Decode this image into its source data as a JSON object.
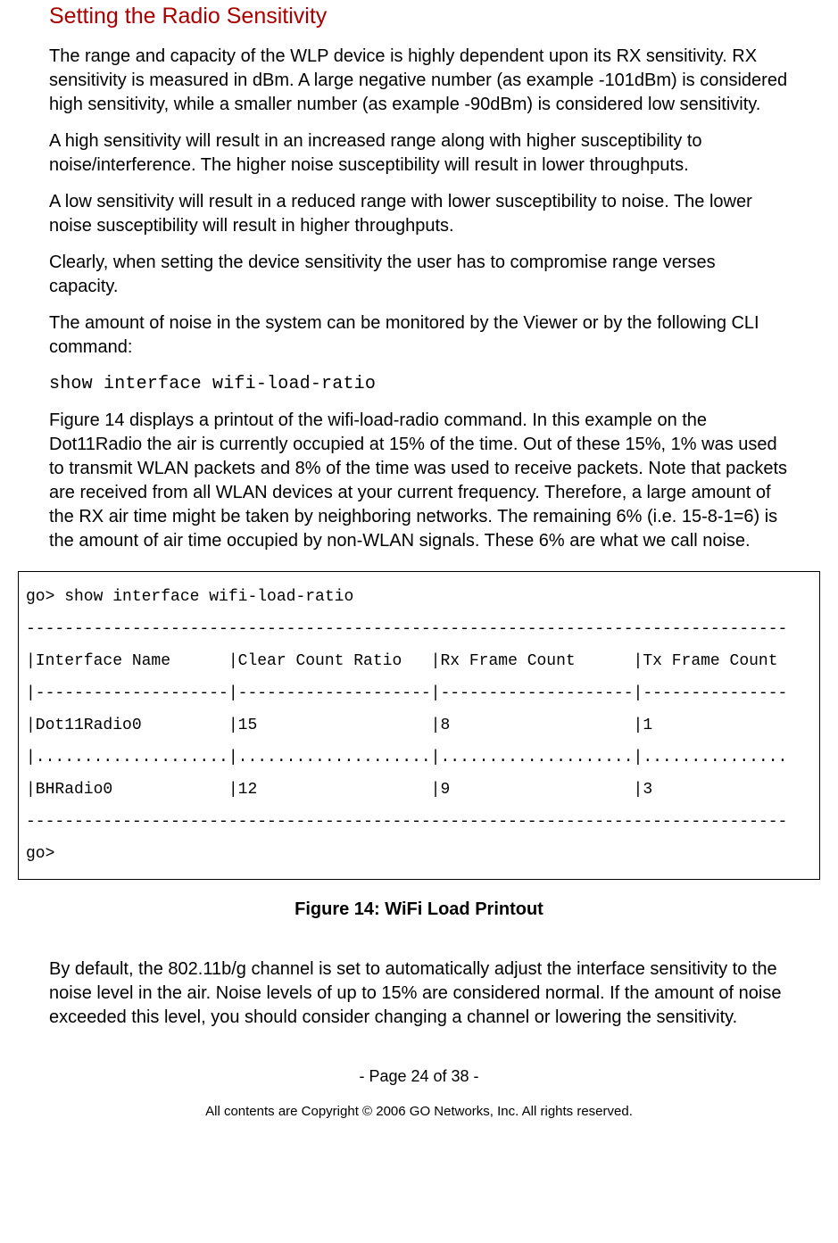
{
  "heading": "Setting the Radio Sensitivity",
  "paragraphs": {
    "p1": "The range and capacity of the WLP device is highly dependent upon its RX sensitivity. RX sensitivity is measured in dBm. A large negative number (as example -101dBm) is considered high sensitivity, while a smaller number (as example -90dBm) is considered low sensitivity.",
    "p2": "A high sensitivity will result in an increased range along with higher susceptibility to noise/interference. The higher noise susceptibility will result in lower throughputs.",
    "p3": "A low sensitivity will result in a reduced range with lower susceptibility to noise. The lower noise susceptibility will result in higher throughputs.",
    "p4": "Clearly, when setting the device sensitivity the user has to compromise range verses capacity.",
    "p5": "The amount of noise in the system can be monitored by the Viewer or by the following CLI command:",
    "cli": "show interface wifi-load-ratio",
    "p6": "Figure 14 displays a printout of the wifi-load-radio command. In this example on the Dot11Radio the air is currently occupied at 15% of the time. Out of these 15%, 1% was used to transmit WLAN packets and 8% of the time was used to receive packets. Note that packets are received from all WLAN devices at your current frequency. Therefore, a large amount of the RX air time might be taken by neighboring networks.  The remaining 6% (i.e. 15-8-1=6) is the amount of air time occupied by non-WLAN signals. These 6% are what we call noise.",
    "p7": "By default, the 802.11b/g channel is set to automatically adjust the interface sensitivity to the noise level in the air. Noise levels of up to 15% are considered normal. If the amount of noise exceeded this level, you should consider changing a channel or lowering the sensitivity."
  },
  "code": {
    "prompt_cmd": "go> show interface wifi-load-ratio",
    "border_top": "-------------------------------------------------------------------------------",
    "header_row": "|Interface Name      |Clear Count Ratio   |Rx Frame Count      |Tx Frame Count",
    "sep1": "|--------------------|--------------------|--------------------|---------------",
    "row1": "|Dot11Radio0         |15                  |8                   |1",
    "sep2": "|....................|....................|....................|...............",
    "row2": "|BHRadio0            |12                  |9                   |3",
    "border_bottom": "-------------------------------------------------------------------------------",
    "prompt_end": "go>"
  },
  "figure_caption": "Figure 14:  WiFi Load Printout",
  "footer": {
    "page": "- Page 24 of 38 -",
    "copyright": "All contents are Copyright © 2006 GO Networks, Inc. All rights reserved."
  },
  "chart_data": {
    "type": "table",
    "title": "wifi-load-ratio",
    "columns": [
      "Interface Name",
      "Clear Count Ratio",
      "Rx Frame Count",
      "Tx Frame Count"
    ],
    "rows": [
      {
        "Interface Name": "Dot11Radio0",
        "Clear Count Ratio": 15,
        "Rx Frame Count": 8,
        "Tx Frame Count": 1
      },
      {
        "Interface Name": "BHRadio0",
        "Clear Count Ratio": 12,
        "Rx Frame Count": 9,
        "Tx Frame Count": 3
      }
    ]
  }
}
